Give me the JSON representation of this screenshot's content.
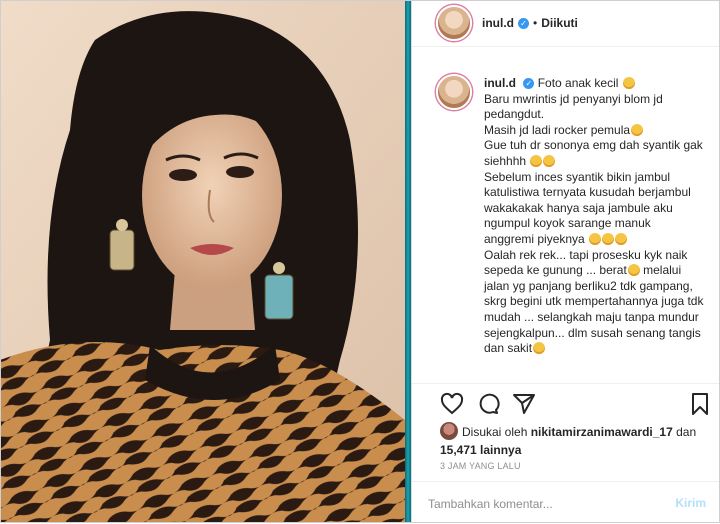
{
  "post": {
    "username": "inul.d",
    "verified_icon": "verified-badge-icon",
    "separator": "•",
    "follow_status": "Diikuti"
  },
  "caption": {
    "username": "inul.d",
    "lines": [
      "Foto anak kecil",
      "Baru mwrintis jd penyanyi blom jd pedangdut.",
      "Masih jd ladi rocker pemula",
      "Gue tuh dr sononya emg dah syantik gak siehhhh",
      "Sebelum inces syantik bikin jambul katulistiwa ternyata kusudah berjambul wakakakak hanya saja jambule aku ngumpul koyok sarange manuk anggremi piyeknya",
      "Oalah rek rek... tapi prosesku kyk naik sepeda ke gunung ... berat",
      "melalui jalan yg panjang berliku2 tdk gampang, skrg begini utk mempertahannya juga tdk mudah ... selangkah maju tanpa mundur sejengkalpun... dlm susah senang tangis dan sakit"
    ]
  },
  "likes": {
    "prefix": "Disukai oleh",
    "user": "nikitamirzanimawardi_17",
    "conj": "dan",
    "count": "15,471",
    "suffix": "lainnya"
  },
  "timestamp": "3 JAM YANG LALU",
  "comment": {
    "placeholder": "Tambahkan komentar...",
    "post_label": "Kirim"
  },
  "colors": {
    "verified": "#3897f0",
    "post_button_disabled": "#b2dffc",
    "teal_frame": "#1aa0ae"
  }
}
